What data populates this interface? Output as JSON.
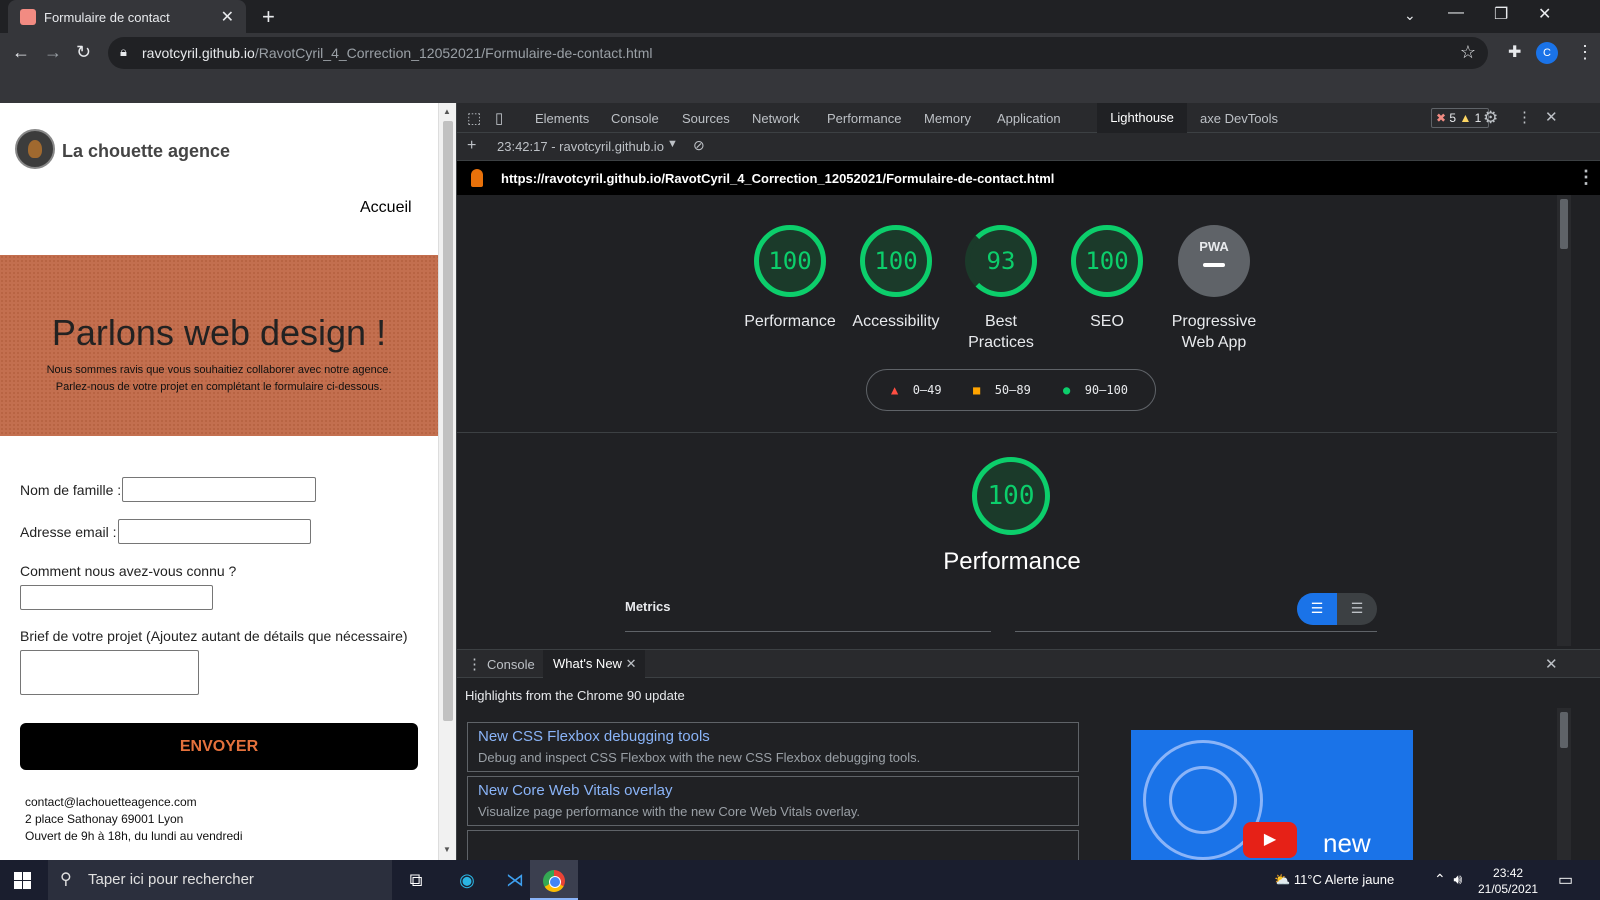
{
  "browser": {
    "tab_title": "Formulaire de contact",
    "url_host": "ravotcyril.github.io",
    "url_path": "/RavotCyril_4_Correction_12052021/Formulaire-de-contact.html",
    "profile_initial": "C"
  },
  "page": {
    "brand": "La chouette agence",
    "nav_home": "Accueil",
    "hero_title": "Parlons web design !",
    "hero_text_1": "Nous sommes ravis que vous souhaitiez collaborer avec notre agence.",
    "hero_text_2": "Parlez-nous de votre projet en complétant le formulaire ci-dessous.",
    "label_name": "Nom de famille :",
    "label_email": "Adresse email :",
    "label_source": "Comment nous avez-vous connu ?",
    "label_brief": "Brief de votre projet (Ajoutez autant de détails que nécessaire)",
    "submit": "ENVOYER",
    "footer_email": "contact@lachouetteagence.com",
    "footer_address": "2 place Sathonay 69001 Lyon",
    "footer_hours": "Ouvert de 9h à 18h, du lundi au vendredi"
  },
  "devtools": {
    "tabs": [
      "Elements",
      "Console",
      "Sources",
      "Network",
      "Performance",
      "Memory",
      "Application"
    ],
    "active_tab": "Lighthouse",
    "extra_tab": "axe DevTools",
    "errors": "5",
    "warnings": "1",
    "report_selector": "23:42:17 - ravotcyril.github.io",
    "report_url": "https://ravotcyril.github.io/RavotCyril_4_Correction_12052021/Formulaire-de-contact.html",
    "scores": [
      {
        "label": "Performance",
        "value": "100"
      },
      {
        "label": "Accessibility",
        "value": "100"
      },
      {
        "label": "Best Practices",
        "value": "93"
      },
      {
        "label": "SEO",
        "value": "100"
      }
    ],
    "pwa_label": "Progressive Web App",
    "pwa_badge": "PWA",
    "legend": {
      "low": "0–49",
      "mid": "50–89",
      "high": "90–100"
    },
    "perf_score": "100",
    "perf_title": "Performance",
    "metrics_label": "Metrics",
    "colors": {
      "pass": "#0cce6b",
      "average": "#ffa400",
      "fail": "#ff4e42"
    }
  },
  "drawer": {
    "tab_console": "Console",
    "tab_whatsnew": "What's New",
    "highlights": "Highlights from the Chrome 90 update",
    "cards": [
      {
        "title": "New CSS Flexbox debugging tools",
        "desc": "Debug and inspect CSS Flexbox with the new CSS Flexbox debugging tools."
      },
      {
        "title": "New Core Web Vitals overlay",
        "desc": "Visualize page performance with the new Core Web Vitals overlay."
      }
    ],
    "promo_text": "new"
  },
  "taskbar": {
    "search_placeholder": "Taper ici pour rechercher",
    "weather": "11°C  Alerte jaune",
    "time": "23:42",
    "date": "21/05/2021"
  }
}
